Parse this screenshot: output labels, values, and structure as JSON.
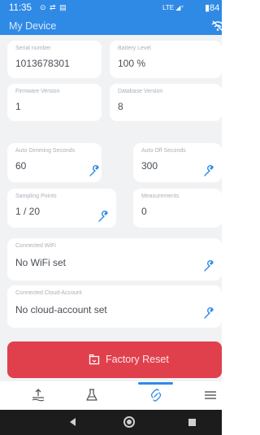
{
  "status_bar": {
    "time": "11:35",
    "icons": "⊙ ⇄ ▤",
    "network": "LTE ◢⁺",
    "battery": "▮84"
  },
  "app_bar": {
    "title": "My Device"
  },
  "fields": {
    "serial_number": {
      "label": "Serial number",
      "value": "1013678301"
    },
    "battery_level": {
      "label": "Battery Level",
      "value": "100 %"
    },
    "firmware_version": {
      "label": "Firmware Version",
      "value": "1"
    },
    "database_version": {
      "label": "Database Version",
      "value": "8"
    },
    "auto_dimming": {
      "label": "Auto Dimming Seconds",
      "value": "60"
    },
    "auto_off": {
      "label": "Auto Off Seconds",
      "value": "300"
    },
    "sampling_points": {
      "label": "Sampling Points",
      "value": "1 / 20"
    },
    "measurements": {
      "label": "Measurements",
      "value": "0"
    },
    "connected_wifi": {
      "label": "Connected WiFi",
      "value": "No WiFi set"
    },
    "connected_cloud": {
      "label": "Connected Cloud-Account",
      "value": "No cloud-account set"
    }
  },
  "factory_reset": {
    "label": "Factory Reset"
  },
  "bottom_nav": {
    "active_tab": "device"
  },
  "colors": {
    "primary": "#2f8ae6",
    "danger": "#e0404c",
    "background": "#f1f2f4"
  }
}
